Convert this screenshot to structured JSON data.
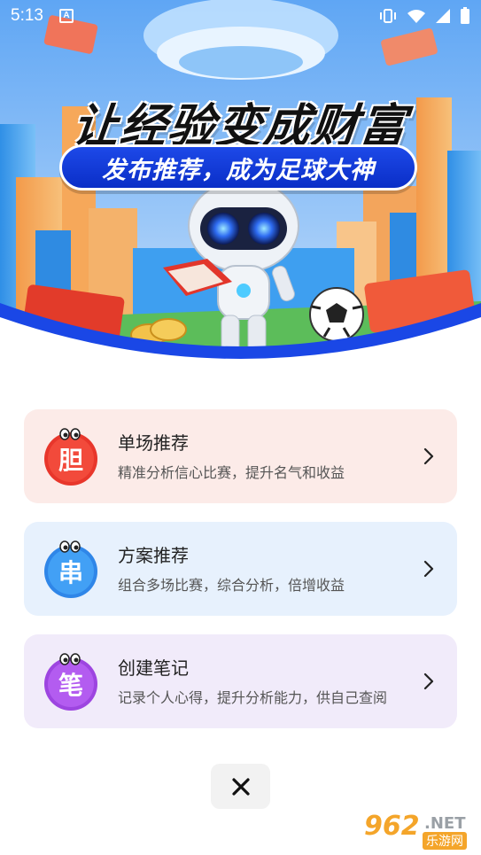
{
  "status_bar": {
    "time": "5:13",
    "notification_icon_letter": "A",
    "icons": [
      "vibrate-icon",
      "wifi-icon",
      "signal-icon",
      "battery-icon"
    ]
  },
  "hero": {
    "title": "让经验变成财富",
    "subtitle": "发布推荐，成为足球大神",
    "colors": {
      "sky": "#5aa4f3",
      "pill": "#1d49e8",
      "arc": "#1a47e6"
    }
  },
  "options": [
    {
      "badge_char": "胆",
      "title": "单场推荐",
      "description": "精准分析信心比赛，提升名气和收益",
      "color": "#fcebe8",
      "badge_color": "#e8362b"
    },
    {
      "badge_char": "串",
      "title": "方案推荐",
      "description": "组合多场比赛，综合分析，倍增收益",
      "color": "#e7f1fd",
      "badge_color": "#2f86e8"
    },
    {
      "badge_char": "笔",
      "title": "创建笔记",
      "description": "记录个人心得，提升分析能力，供自己查阅",
      "color": "#f1ebfa",
      "badge_color": "#9d45e0"
    }
  ],
  "close": {
    "icon": "close-icon"
  },
  "watermark": {
    "number": "962",
    "suffix": ".NET",
    "site": "乐游网"
  }
}
